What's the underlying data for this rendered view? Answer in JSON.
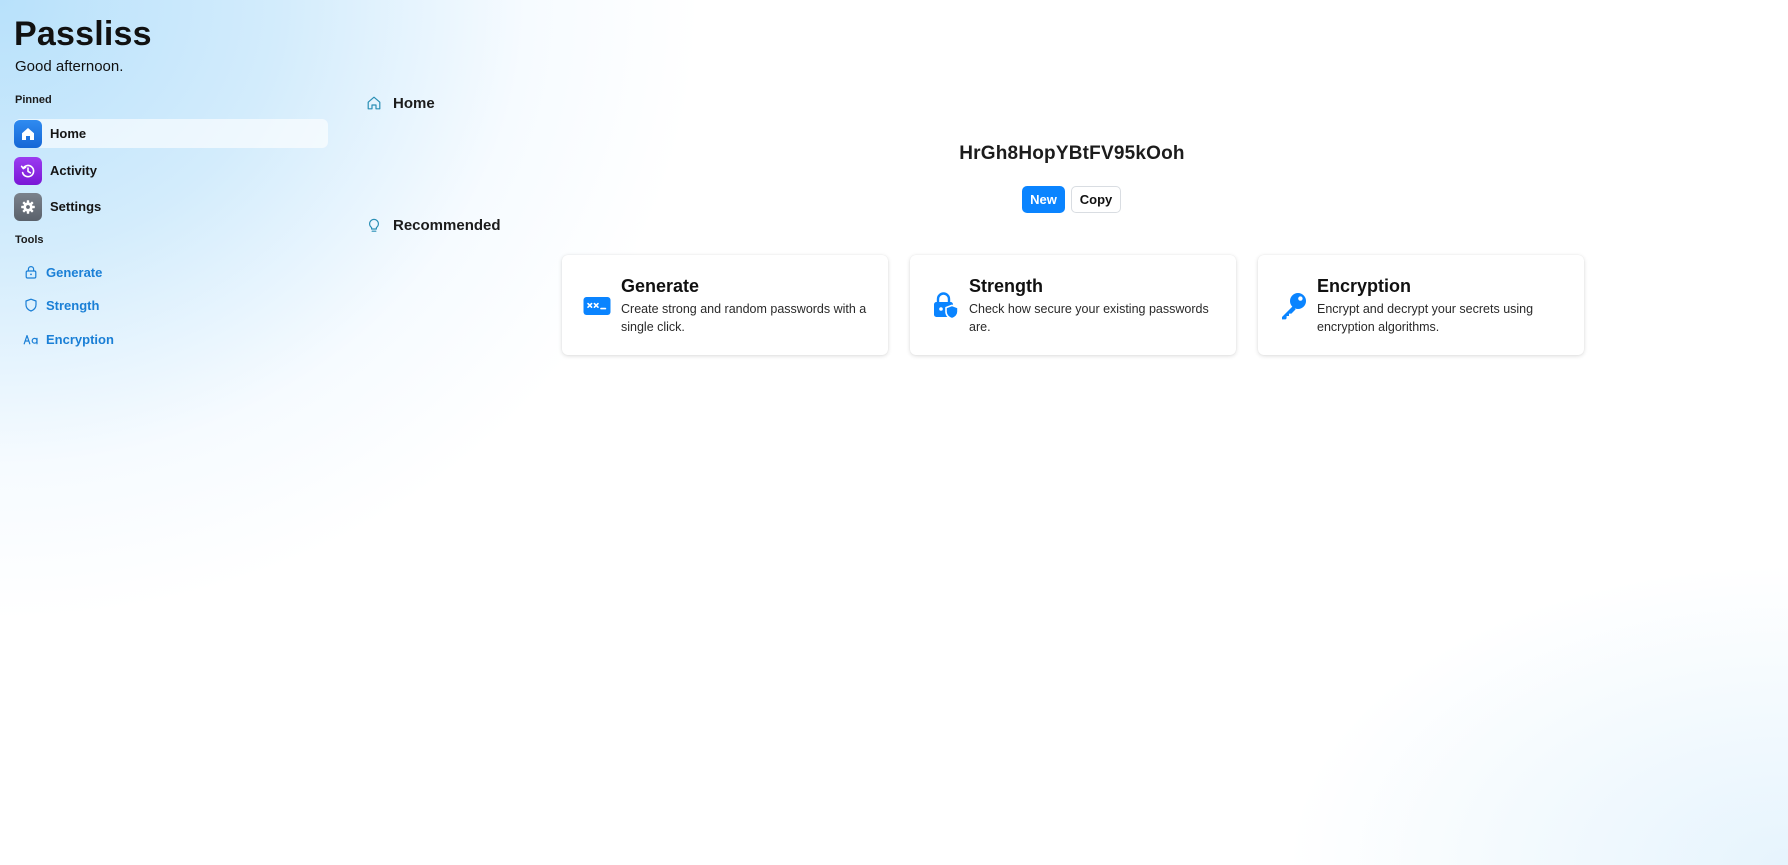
{
  "app": {
    "title": "Passliss",
    "greeting": "Good afternoon."
  },
  "sidebar": {
    "pinned_label": "Pinned",
    "pinned": [
      {
        "label": "Home",
        "icon": "home-icon",
        "color": "#1a73e8",
        "active": true
      },
      {
        "label": "Activity",
        "icon": "history-icon",
        "color": "#8a2be2",
        "active": false
      },
      {
        "label": "Settings",
        "icon": "gear-icon",
        "color": "#6b7280",
        "active": false
      }
    ],
    "tools_label": "Tools",
    "tools": [
      {
        "label": "Generate",
        "icon": "lock-icon"
      },
      {
        "label": "Strength",
        "icon": "shield-icon"
      },
      {
        "label": "Encryption",
        "icon": "translate-icon"
      }
    ]
  },
  "main": {
    "home_heading": "Home",
    "password": "HrGh8HopYBtFV95kOoh",
    "new_button": "New",
    "copy_button": "Copy",
    "recommended_heading": "Recommended",
    "cards": [
      {
        "title": "Generate",
        "description": "Create strong and random passwords with a single click.",
        "icon": "password-icon"
      },
      {
        "title": "Strength",
        "description": "Check how secure your existing passwords are.",
        "icon": "lock-shield-icon"
      },
      {
        "title": "Encryption",
        "description": "Encrypt and decrypt your secrets using encryption algorithms.",
        "icon": "key-icon"
      }
    ]
  },
  "colors": {
    "accent": "#0a84ff",
    "tool_text": "#1a7fd6",
    "sidebar_gradient": "#b8e1fb"
  }
}
